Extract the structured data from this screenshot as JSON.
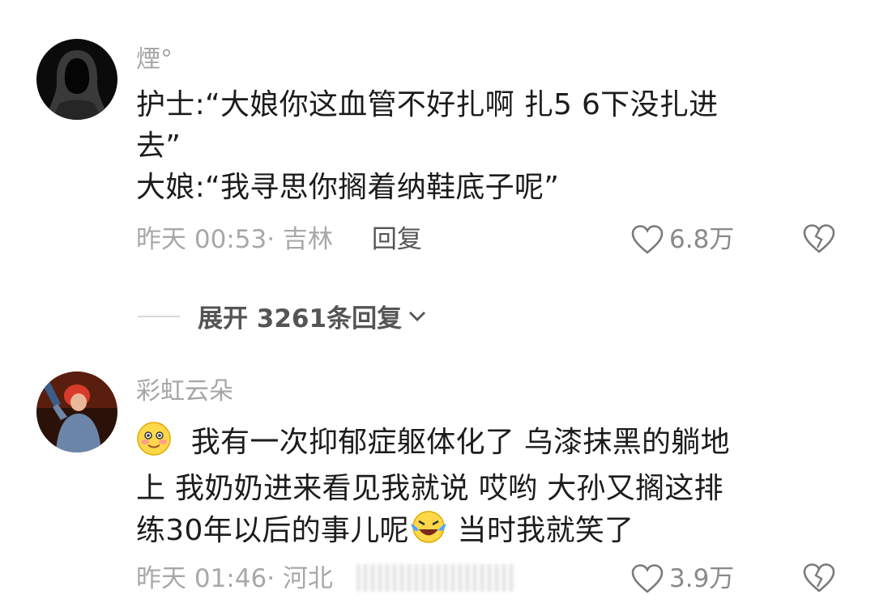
{
  "comments": [
    {
      "username": "煙°",
      "lines": [
        "护士:“大娘你这血管不好扎啊 扎5 6下没扎进",
        "去”",
        "大娘:“我寻思你搁着纳鞋底子呢”"
      ],
      "meta": "昨天 00:53· 吉林",
      "reply_label": "回复",
      "likes": "6.8万",
      "avatar_icon": "hooded-figure-avatar"
    },
    {
      "username": "彩虹云朵",
      "emoji_start": "blushing-smile-emoji",
      "line1": "我有一次抑郁症躯体化了 乌漆抹黑的躺地",
      "line2": "上 我奶奶进来看见我就说 哎哟 大孙又搁这排",
      "line3_a": "练30年以后的事儿呢",
      "emoji_mid": "laughing-tears-emoji",
      "line3_b": " 当时我就笑了",
      "meta": "昨天 01:46· 河北",
      "likes": "3.9万",
      "avatar_icon": "red-hair-performer-avatar"
    }
  ],
  "expand": {
    "label": "展开 3261条回复"
  },
  "colors": {
    "meta_gray": "#a8a8a8",
    "text_dark": "#1c1c1c"
  }
}
